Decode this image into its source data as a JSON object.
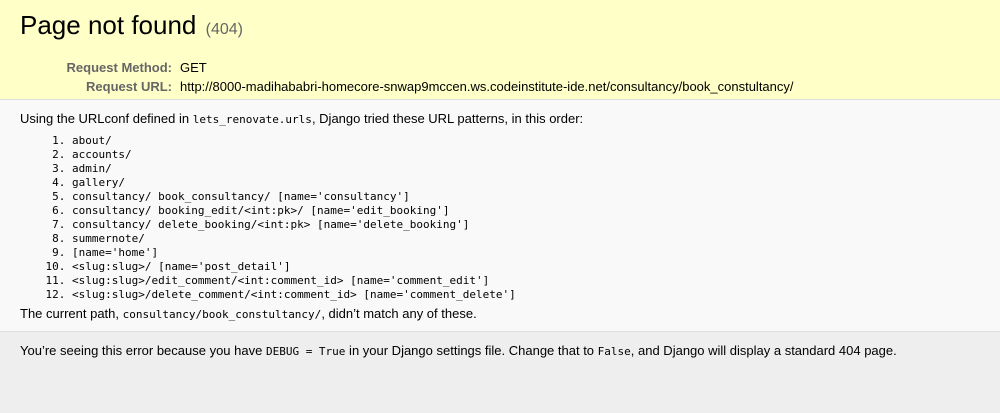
{
  "summary": {
    "title": "Page not found",
    "code": "(404)",
    "request_method_label": "Request Method:",
    "request_method": "GET",
    "request_url_label": "Request URL:",
    "request_url": "http://8000-madihababri-homecore-snwap9mccen.ws.codeinstitute-ide.net/consultancy/book_constultancy/"
  },
  "info": {
    "intro_before": "Using the URLconf defined in ",
    "urlconf": "lets_renovate.urls",
    "intro_after": ", Django tried these URL patterns, in this order:",
    "patterns": [
      "about/",
      "accounts/",
      "admin/",
      "gallery/",
      "consultancy/ book_consultancy/ [name='consultancy']",
      "consultancy/ booking_edit/<int:pk>/ [name='edit_booking']",
      "consultancy/ delete_booking/<int:pk> [name='delete_booking']",
      "summernote/",
      "[name='home']",
      "<slug:slug>/ [name='post_detail']",
      "<slug:slug>/edit_comment/<int:comment_id> [name='comment_edit']",
      "<slug:slug>/delete_comment/<int:comment_id> [name='comment_delete']"
    ],
    "current_before": "The current path, ",
    "current_path": "consultancy/book_constultancy/",
    "current_after": ", didn’t match any of these."
  },
  "explanation": {
    "part1": "You’re seeing this error because you have ",
    "debug_code": "DEBUG = True",
    "part2": " in your Django settings file. Change that to ",
    "false_code": "False",
    "part3": ", and Django will display a standard 404 page."
  }
}
